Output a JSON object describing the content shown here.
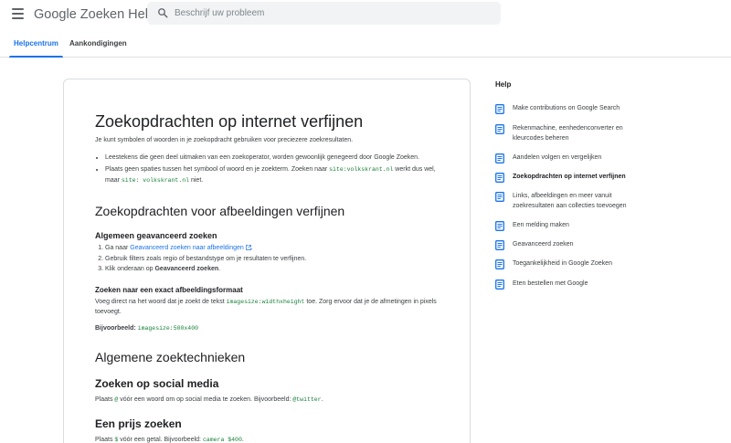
{
  "header": {
    "app_title": "Google Zoeken Help",
    "search_placeholder": "Beschrijf uw probleem",
    "menu_icon": "hamburger-menu-icon",
    "search_icon": "search-icon"
  },
  "tabs": [
    {
      "label": "Helpcentrum",
      "active": true
    },
    {
      "label": "Aankondigingen",
      "active": false
    }
  ],
  "article": {
    "title": "Zoekopdrachten op internet verfijnen",
    "intro": "Je kunt symbolen of woorden in je zoekopdracht gebruiken voor preciezere zoekresultaten.",
    "bullets": {
      "b1": "Leestekens die geen deel uitmaken van een zoekoperator, worden gewoonlijk genegeerd door Google Zoeken.",
      "b2_pre": "Plaats geen spaties tussen het symbool of woord en je zoekterm. Zoeken naar ",
      "b2_code1": "site:volkskrant.nl",
      "b2_mid": " werkt dus wel, maar ",
      "b2_code2": "site: volkskrant.nl",
      "b2_post": " niet."
    },
    "images_section": {
      "heading": "Zoekopdrachten voor afbeeldingen verfijnen",
      "advanced_heading": "Algemeen geavanceerd zoeken",
      "step1_pre": "Ga naar ",
      "step1_link": "Geavanceerd zoeken naar afbeeldingen",
      "step1_post": ".",
      "step2": "Gebruik filters zoals regio of bestandstype om je resultaten te verfijnen.",
      "step3_pre": "Klik onderaan op ",
      "step3_bold": "Geavanceerd zoeken",
      "step3_post": ".",
      "format_heading": "Zoeken naar een exact afbeeldingsformaat",
      "format_pre": "Voeg direct na het woord dat je zoekt de tekst ",
      "format_code": "imagesize:widthxheight",
      "format_post": " toe. Zorg ervoor dat je de afmetingen in pixels toevoegt.",
      "example_label": "Bijvoorbeeld:",
      "example_code": "imagesize:500x400"
    },
    "general_section": {
      "heading": "Algemene zoektechnieken",
      "social_heading": "Zoeken op social media",
      "social_pre": "Plaats ",
      "social_code1": "@",
      "social_mid": " vóór een woord om op social media te zoeken. Bijvoorbeeld: ",
      "social_code2": "@twitter",
      "social_post": ".",
      "price_heading": "Een prijs zoeken",
      "price_pre": "Plaats ",
      "price_code1": "$",
      "price_mid": " vóór een getal. Bijvoorbeeld: ",
      "price_code2": "camera $400",
      "price_post": "."
    }
  },
  "sidebar": {
    "title": "Help",
    "items": [
      {
        "label": "Make contributions on Google Search",
        "current": false
      },
      {
        "label": "Rekenmachine, eenhedenconverter en kleurcodes beheren",
        "current": false
      },
      {
        "label": "Aandelen volgen en vergelijken",
        "current": false
      },
      {
        "label": "Zoekopdrachten op internet verfijnen",
        "current": true
      },
      {
        "label": "Links, afbeeldingen en meer vanuit zoekresultaten aan collecties toevoegen",
        "current": false
      },
      {
        "label": "Een melding maken",
        "current": false
      },
      {
        "label": "Geavanceerd zoeken",
        "current": false
      },
      {
        "label": "Toegankelijkheid in Google Zoeken",
        "current": false
      },
      {
        "label": "Eten bestellen met Google",
        "current": false
      }
    ],
    "item_icon": "article-icon",
    "accent_color": "#1a73e8"
  }
}
